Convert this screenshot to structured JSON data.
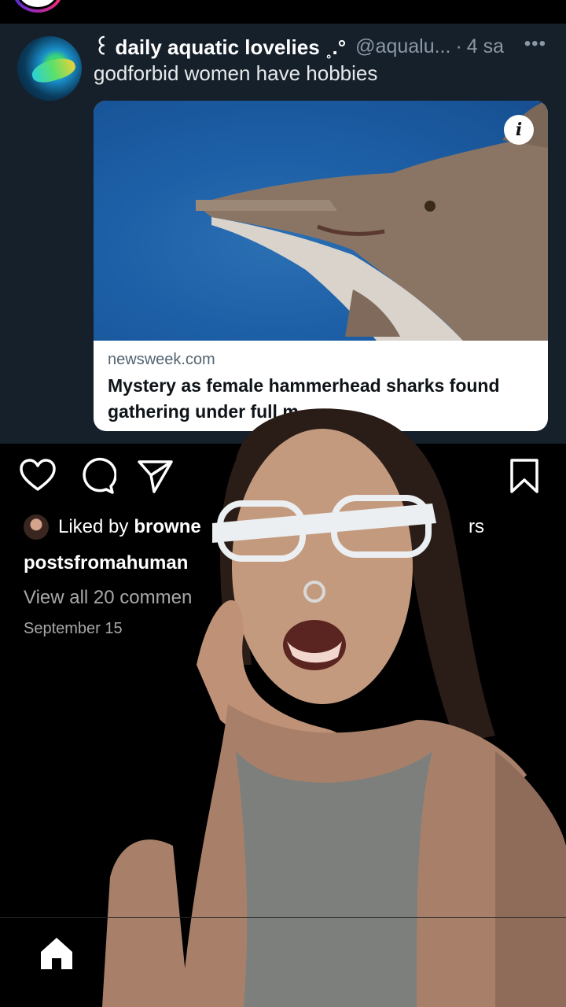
{
  "tweet": {
    "display_name": "꒰ daily aquatic lovelies ˳.°",
    "handle": "@aqualu...",
    "separator": "·",
    "time": "4 sa",
    "more": "•••",
    "text": "godforbid women have hobbies",
    "card": {
      "domain": "newsweek.com",
      "title": "Mystery as female hammerhead sharks found gathering under full m"
    }
  },
  "instagram": {
    "liked_prefix": "Liked by",
    "liked_user": "browne",
    "liked_suffix": "rs",
    "username": "postsfromahuman",
    "view_comments": "View all 20 commen",
    "date": "September 15"
  },
  "icons": {
    "story": "story-ring-icon",
    "card_info": "info-icon",
    "like": "heart-icon",
    "comment": "comment-icon",
    "share": "send-icon",
    "save": "bookmark-icon",
    "home": "home-icon"
  },
  "colors": {
    "tweet_bg": "#15202b",
    "handle_gray": "#8b98a5",
    "card_bg": "#ffffff",
    "ig_bg": "#000000",
    "secondary_text": "#a8a8a8"
  }
}
